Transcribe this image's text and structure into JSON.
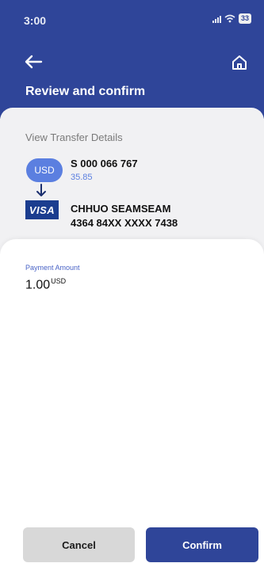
{
  "status_bar": {
    "time": "3:00",
    "battery": "33"
  },
  "header": {
    "title": "Review and confirm"
  },
  "details": {
    "section_label": "View Transfer Details",
    "source": {
      "currency": "USD",
      "account_number": "S 000 066 767",
      "balance": "35.85"
    },
    "destination": {
      "brand": "VISA",
      "name": "CHHUO SEAMSEAM",
      "card_number": "4364 84XX XXXX 7438"
    }
  },
  "payment": {
    "label": "Payment Amount",
    "amount": "1.00",
    "currency": "USD"
  },
  "actions": {
    "cancel": "Cancel",
    "confirm": "Confirm"
  },
  "colors": {
    "primary": "#2f4599",
    "accent": "#5b7fe0",
    "card_bg": "#f1f1f3",
    "cancel_bg": "#d8d8d8"
  },
  "icons": {
    "back": "arrow-left-icon",
    "home": "home-icon",
    "transfer": "arrow-down-icon"
  }
}
